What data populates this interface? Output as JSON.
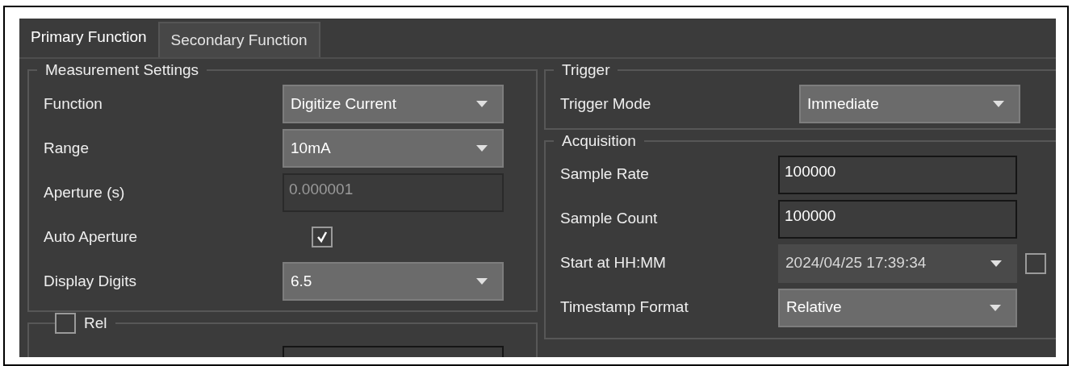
{
  "tabs": [
    {
      "label": "Primary Function",
      "selected": true
    },
    {
      "label": "Secondary Function",
      "selected": false
    }
  ],
  "measurement_settings": {
    "title": "Measurement Settings",
    "rows": [
      {
        "kind": "dropdown",
        "label": "Function",
        "value": "Digitize Current",
        "disabled": false
      },
      {
        "kind": "dropdown",
        "label": "Range",
        "value": "10mA",
        "disabled": false
      },
      {
        "kind": "text",
        "label": "Aperture (s)",
        "value": "0.000001",
        "disabled": true
      },
      {
        "kind": "checkbox",
        "label": "Auto Aperture",
        "checked": true
      },
      {
        "kind": "dropdown",
        "label": "Display Digits",
        "value": "6.5",
        "disabled": false
      }
    ]
  },
  "rel": {
    "label": "Rel",
    "checked": false
  },
  "trigger": {
    "title": "Trigger",
    "rows": [
      {
        "kind": "dropdown",
        "label": "Trigger Mode",
        "value": "Immediate",
        "disabled": false
      }
    ]
  },
  "acquisition": {
    "title": "Acquisition",
    "rows": [
      {
        "kind": "text",
        "label": "Sample Rate",
        "value": "100000",
        "disabled": false
      },
      {
        "kind": "text",
        "label": "Sample Count",
        "value": "100000",
        "disabled": false
      },
      {
        "kind": "dropdown",
        "label": "Start at HH:MM",
        "value": "2024/04/25 17:39:34",
        "disabled": true,
        "enable_checked": false
      },
      {
        "kind": "dropdown",
        "label": "Timestamp Format",
        "value": "Relative",
        "disabled": false
      }
    ]
  }
}
